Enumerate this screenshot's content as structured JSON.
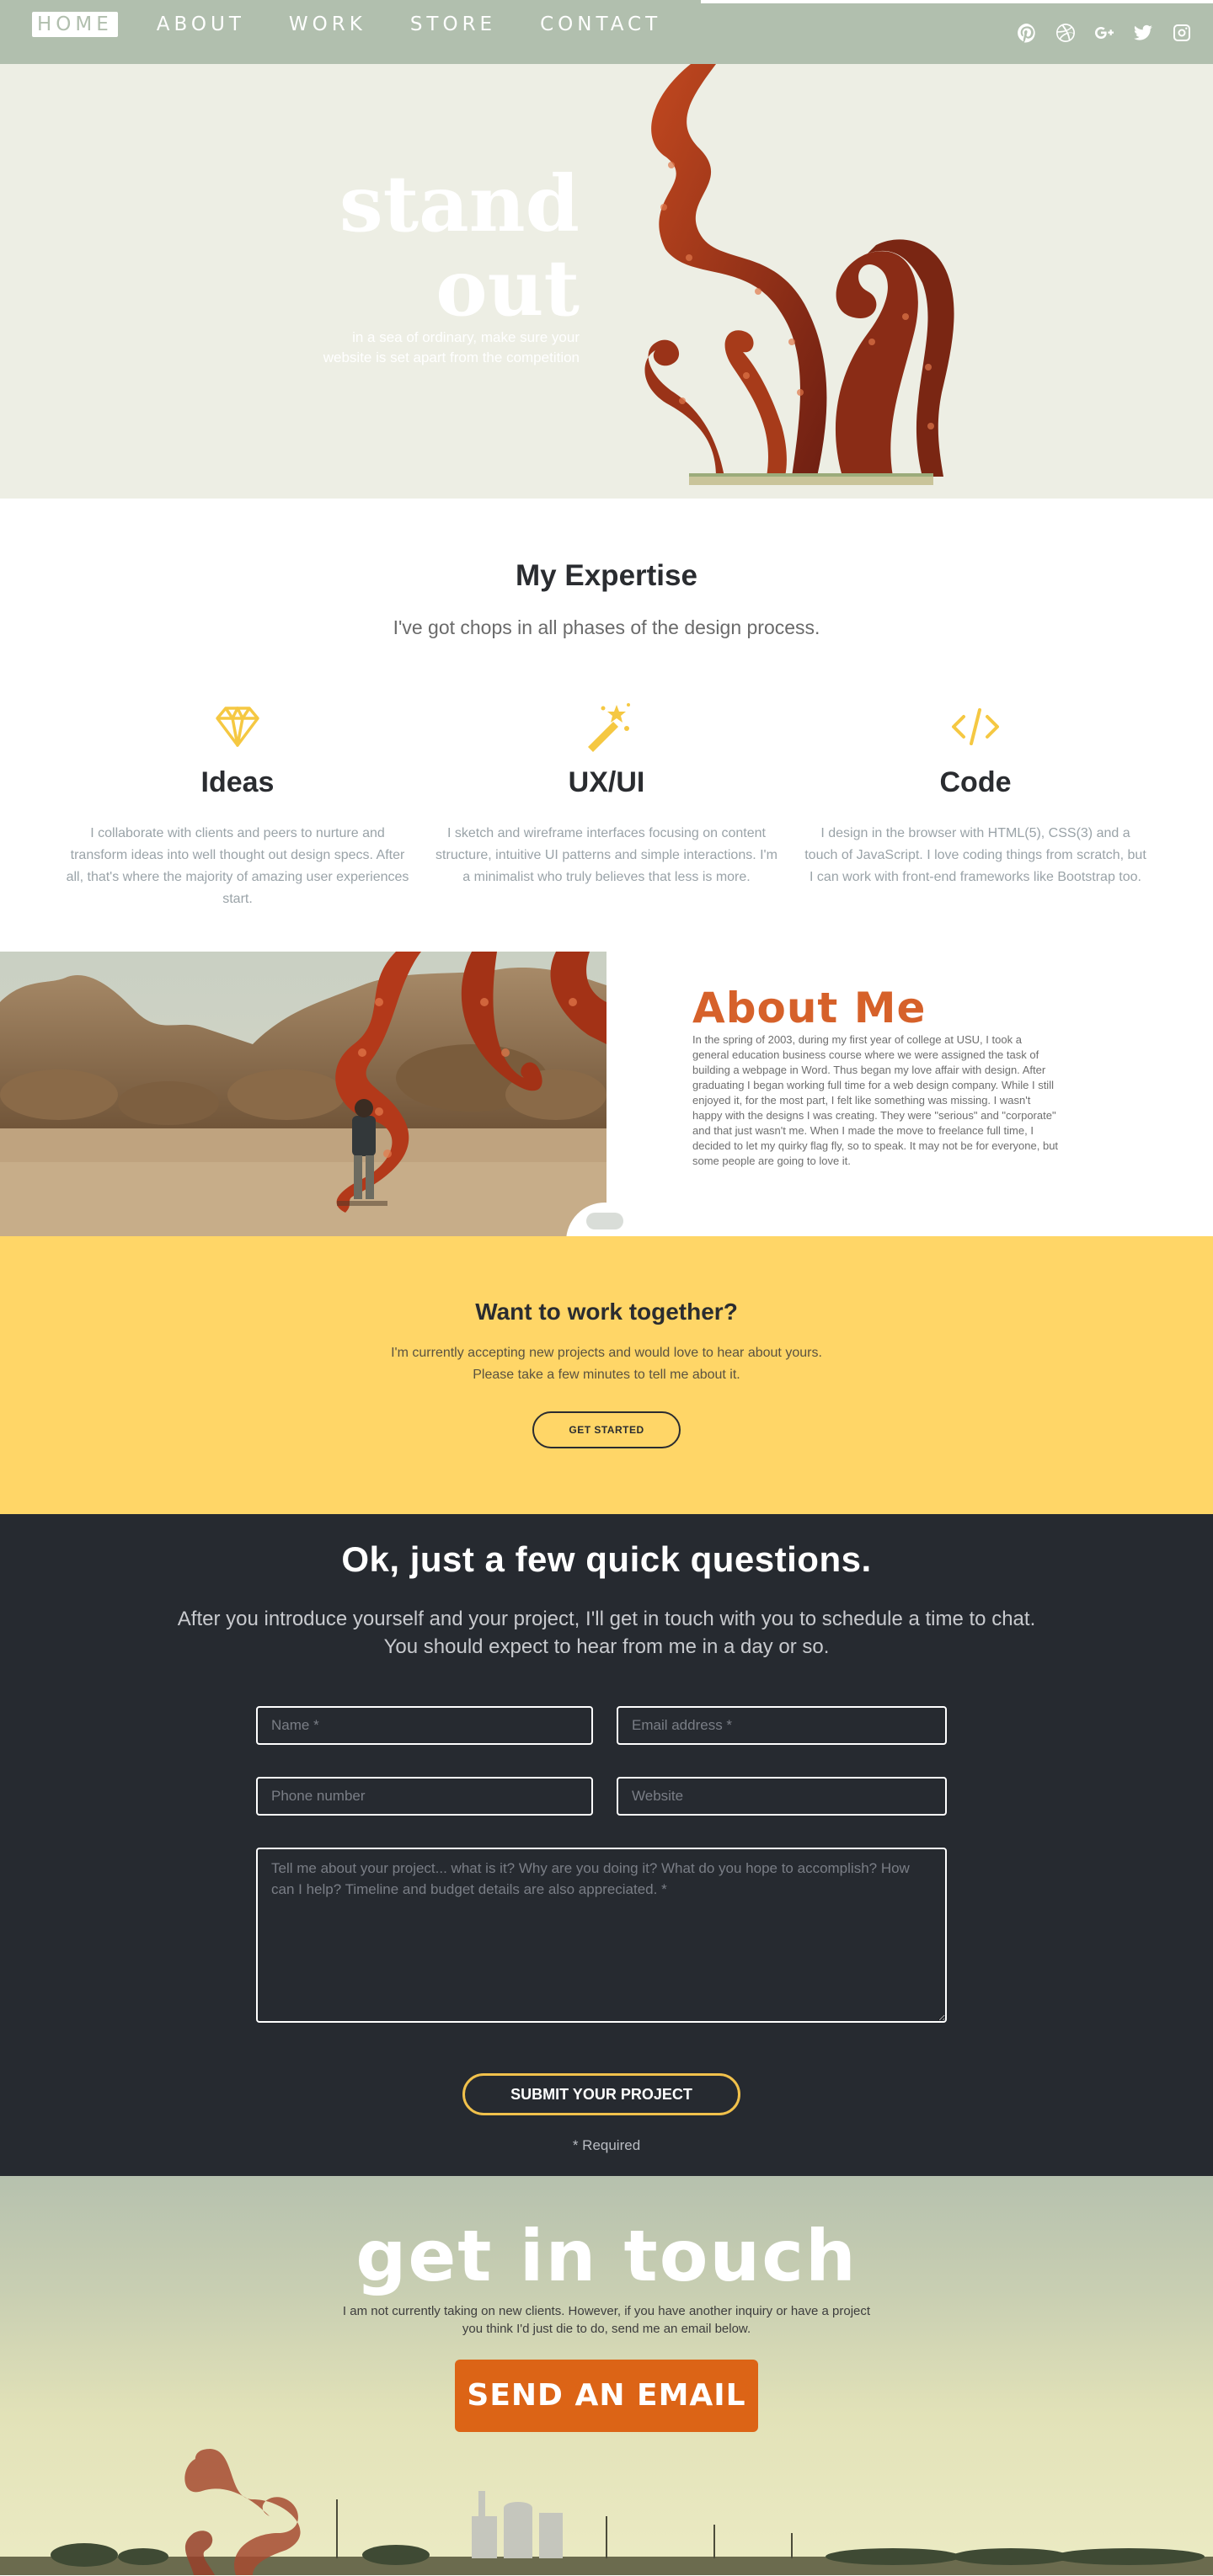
{
  "nav": {
    "links": [
      {
        "label": "HOME",
        "active": true
      },
      {
        "label": "ABOUT"
      },
      {
        "label": "WORK"
      },
      {
        "label": "STORE"
      },
      {
        "label": "CONTACT"
      }
    ],
    "social_icons": [
      "pinterest-icon",
      "dribbble-icon",
      "google-plus-icon",
      "twitter-icon",
      "instagram-icon"
    ]
  },
  "hero": {
    "title_line1": "stand",
    "title_line2": "out",
    "subtitle_line1": "in a sea of ordinary, make sure your",
    "subtitle_line2": "website is set apart from the competition"
  },
  "expertise": {
    "title": "My Expertise",
    "subtitle": "I've got chops in all phases of the design process.",
    "columns": [
      {
        "icon": "diamond-icon",
        "name": "Ideas",
        "text": "I collaborate with clients and peers to nurture and transform ideas into well thought out design specs. After all, that's where the majority of amazing user experiences start."
      },
      {
        "icon": "magic-wand-icon",
        "name": "UX/UI",
        "text": "I sketch and wireframe interfaces focusing on content structure, intuitive UI patterns and simple interactions. I'm a minimalist who truly believes that less is more."
      },
      {
        "icon": "code-icon",
        "name": "Code",
        "text": "I design in the browser with HTML(5), CSS(3) and a touch of JavaScript. I love coding things from scratch, but I can work with front-end frameworks like Bootstrap too."
      }
    ]
  },
  "about": {
    "title": "About Me",
    "text": "In the spring of 2003, during my first year of college at USU, I took a general education business course where we were assigned the task of building a webpage in Word. Thus began my love affair with design. After graduating I began working full time for a web design company. While I still enjoyed it, for the most part, I felt like something was missing. I wasn't happy with the designs I was creating. They were \"serious\" and \"corporate\" and that just wasn't me. When I made the move to freelance full time, I decided to let my quirky flag fly, so to speak. It may not be for everyone, but some people are going to love it."
  },
  "work": {
    "title": "Want to work together?",
    "text_line1": "I'm currently accepting new projects and would love to hear about yours.",
    "text_line2": "Please take a few minutes to tell me about it.",
    "button": "GET STARTED"
  },
  "form": {
    "title": "Ok, just a few quick questions.",
    "subtitle": "After you introduce yourself and your project, I'll get in touch with you to schedule a time to chat. You should expect to hear from me in a day or so.",
    "name_placeholder": "Name *",
    "email_placeholder": "Email address *",
    "phone_placeholder": "Phone number",
    "website_placeholder": "Website",
    "message_placeholder": "Tell me about your project... what is it? Why are you doing it? What do you hope to accomplish? How can I help? Timeline and budget details are also appreciated. *",
    "submit": "SUBMIT YOUR PROJECT",
    "required_note": "* Required"
  },
  "touch": {
    "title": "get in touch",
    "text": "I am not currently taking on new clients. However, if you have another inquiry or have a project you think I'd just die to do, send me an email below.",
    "button": "SEND AN EMAIL"
  },
  "colors": {
    "nav_bg": "#b1bfae",
    "hero_bg": "#edeee4",
    "accent_orange": "#d6612a",
    "accent_yellow": "#ffd667",
    "icon_yellow": "#f5c842",
    "dark_bg": "#262a30",
    "button_orange": "#dc6416"
  }
}
